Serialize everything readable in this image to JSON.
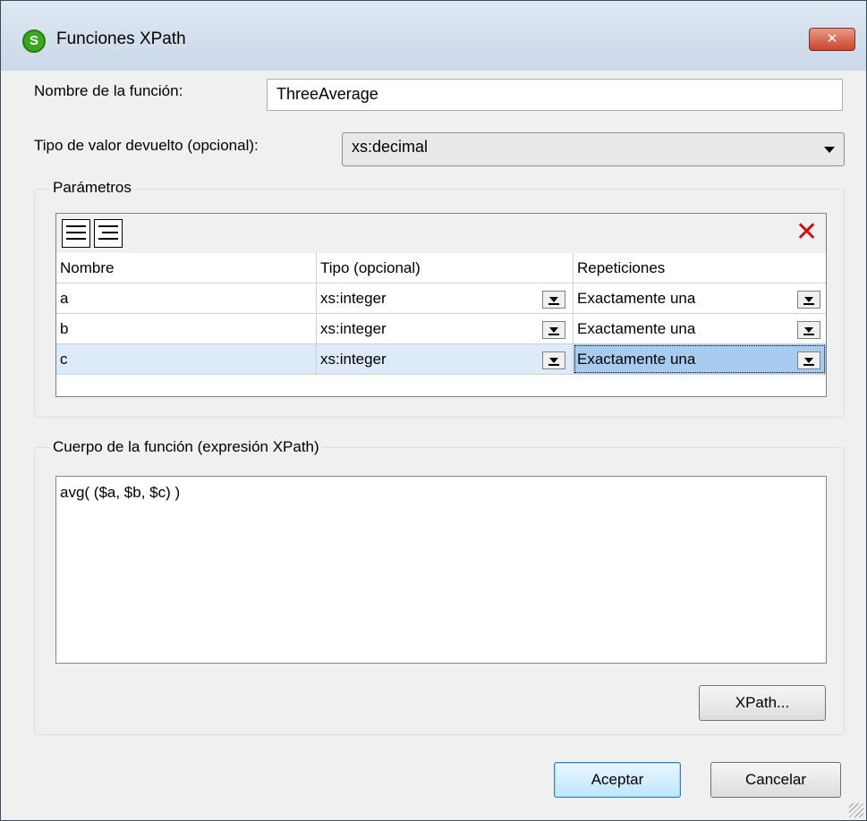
{
  "window": {
    "title": "Funciones XPath",
    "close": "✕"
  },
  "form": {
    "name_label": "Nombre de la función:",
    "name_value": "ThreeAverage",
    "return_label": "Tipo de valor devuelto (opcional):",
    "return_value": "xs:decimal"
  },
  "params": {
    "legend": "Parámetros",
    "columns": [
      "Nombre",
      "Tipo (opcional)",
      "Repeticiones"
    ],
    "rows": [
      {
        "name": "a",
        "type": "xs:integer",
        "reps": "Exactamente una"
      },
      {
        "name": "b",
        "type": "xs:integer",
        "reps": "Exactamente una"
      },
      {
        "name": "c",
        "type": "xs:integer",
        "reps": "Exactamente una"
      }
    ]
  },
  "body": {
    "legend": "Cuerpo de la función (expresión XPath)",
    "expression": "avg( ($a, $b, $c) )",
    "xpath_button": "XPath..."
  },
  "buttons": {
    "ok": "Aceptar",
    "cancel": "Cancelar"
  },
  "colors": {
    "selected_row": "#ddeaf7",
    "selected_cell": "#a8cbf0",
    "delete_icon": "#cc1010",
    "app_icon": "#3aa81e"
  }
}
